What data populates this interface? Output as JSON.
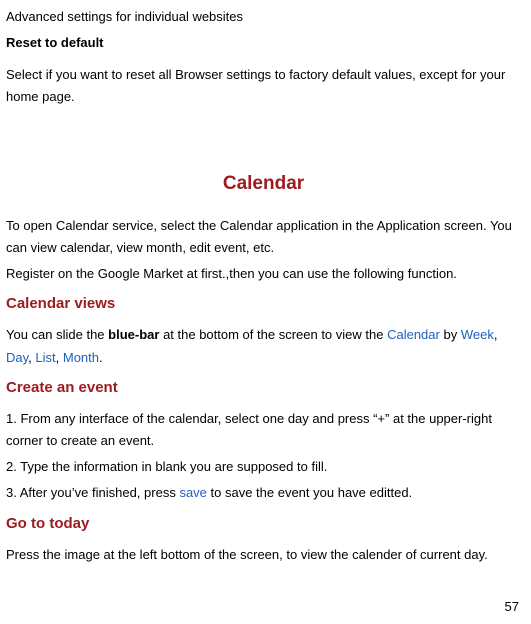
{
  "top": {
    "line1": "Advanced settings for individual websites",
    "reset_label": "Reset to default",
    "reset_desc": "Select if you want to reset all Browser settings to factory default values, except for your home page."
  },
  "calendar": {
    "heading": "Calendar",
    "intro1": "To open Calendar service, select the Calendar application in the Application screen. You can view calendar, view month, edit event, etc.",
    "intro2": "Register on the Google Market at first.,then you can use the following function.",
    "views": {
      "heading": "Calendar views",
      "p_pre": "You can slide the ",
      "bluebar": "blue-bar",
      "p_mid": " at the bottom of the screen to view the ",
      "calendar_word": "Calendar",
      "by": " by ",
      "week": "Week",
      "sep": ", ",
      "day": "Day",
      "list": "List",
      "month": "Month",
      "period": "."
    },
    "create": {
      "heading": "Create an event",
      "s1": "1. From any interface of the calendar, select one day and press “+” at the upper-right corner to create an event.",
      "s2": "2. Type the information in blank you are supposed to fill.",
      "s3_pre": "3. After you’ve finished, press ",
      "save": "save",
      "s3_post": " to save the event you have editted."
    },
    "today": {
      "heading": "Go to today",
      "p": "Press the image at the left bottom of the screen, to view the calender of current day."
    }
  },
  "page_number": "57"
}
